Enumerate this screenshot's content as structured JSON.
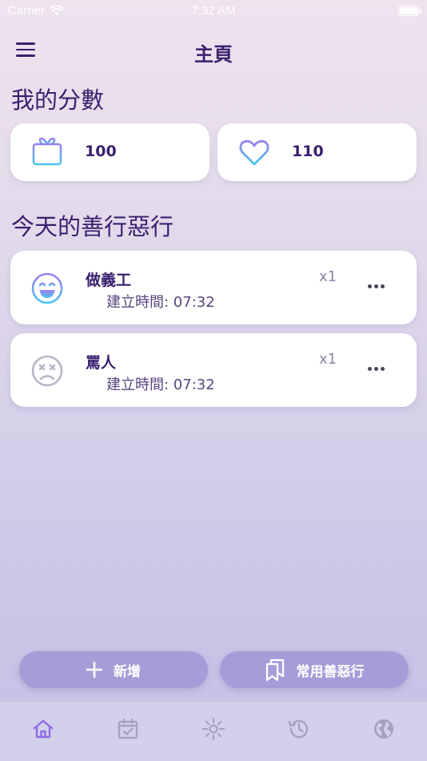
{
  "status_bar": {
    "carrier": "Carrier",
    "time": "7:32 AM"
  },
  "nav": {
    "title": "主頁"
  },
  "scores": {
    "section_title": "我的分數",
    "gift_value": "100",
    "heart_value": "110"
  },
  "deeds": {
    "section_title": "今天的善行惡行",
    "items": [
      {
        "name": "做義工",
        "created": "建立時間: 07:32",
        "count": "x1",
        "face": "smile-icon"
      },
      {
        "name": "罵人",
        "created": "建立時間: 07:32",
        "count": "x1",
        "face": "dizzy-face-icon"
      }
    ]
  },
  "actions": {
    "add_label": "新增",
    "favorites_label": "常用善惡行"
  },
  "tabs": [
    "home-icon",
    "calendar-check-icon",
    "sun-icon",
    "history-icon",
    "globe-icon"
  ],
  "colors": {
    "primary": "#3a1f6e",
    "accent": "#a89cd8",
    "active_tab": "#8f6ce6",
    "inactive_tab": "#a5a3ba"
  }
}
